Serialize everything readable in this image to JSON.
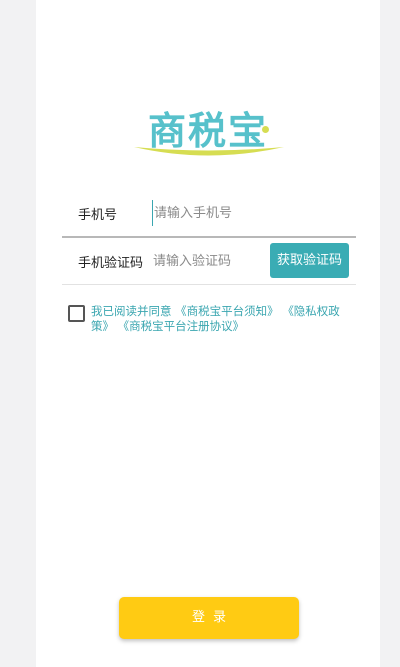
{
  "brand": {
    "logo_text": "商税宝",
    "logo_color": "#57c1cb",
    "accent_color": "#d6dd52"
  },
  "form": {
    "phone": {
      "label": "手机号",
      "placeholder": "请输入手机号",
      "value": ""
    },
    "code": {
      "label": "手机验证码",
      "placeholder": "请输入验证码",
      "value": "",
      "get_code_label": "获取验证码"
    }
  },
  "agreement": {
    "checked": false,
    "prefix": "我已阅读并同意",
    "links": [
      "《商税宝平台须知》",
      "《隐私权政策》",
      "《商税宝平台注册协议》"
    ]
  },
  "login_label": "登录",
  "colors": {
    "primary_teal": "#3aacb4",
    "login_yellow": "#ffcb13",
    "background": "#f2f2f3"
  }
}
